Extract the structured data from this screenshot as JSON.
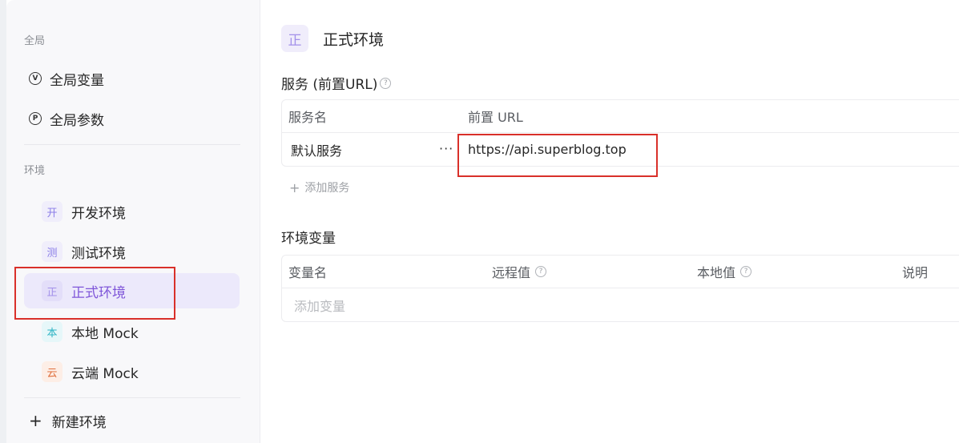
{
  "sidebar": {
    "global_section": "全局",
    "global_items": [
      {
        "label": "全局变量",
        "glyph": "V"
      },
      {
        "label": "全局参数",
        "glyph": "P"
      }
    ],
    "env_section": "环境",
    "envs": [
      {
        "label": "开发环境",
        "badge": "开",
        "badge_color": "#8b7ee8",
        "badge_bg": "#f0eefb"
      },
      {
        "label": "测试环境",
        "badge": "测",
        "badge_color": "#8b7ee8",
        "badge_bg": "#f0eefb"
      },
      {
        "label": "正式环境",
        "badge": "正",
        "badge_color": "#a391ea",
        "badge_bg": "#e3def9"
      },
      {
        "label": "本地 Mock",
        "badge": "本",
        "badge_color": "#2bb3c4",
        "badge_bg": "#e6f7f9"
      },
      {
        "label": "云端 Mock",
        "badge": "云",
        "badge_color": "#e0703e",
        "badge_bg": "#fdeee6"
      }
    ],
    "new_env": "新建环境"
  },
  "main": {
    "env_badge": "正",
    "env_title": "正式环境",
    "services": {
      "title": "服务 (前置URL)",
      "col_name": "服务名",
      "col_url": "前置 URL",
      "rows": [
        {
          "name": "默认服务",
          "url": "https://api.superblog.top"
        }
      ],
      "add_label": "添加服务"
    },
    "variables": {
      "title": "环境变量",
      "col_name": "变量名",
      "col_remote": "远程值",
      "col_local": "本地值",
      "col_desc": "说明",
      "add_placeholder": "添加变量"
    }
  },
  "colors": {
    "accent": "#7f56d9",
    "highlight_box": "#d9302a"
  }
}
